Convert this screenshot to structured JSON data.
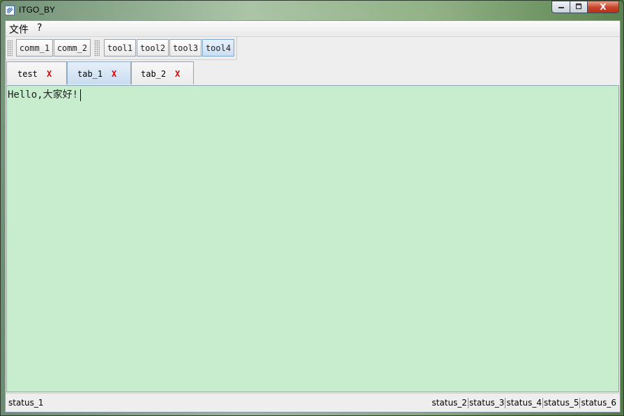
{
  "window": {
    "title": "ITGO_BY",
    "icon": "app-logo-icon",
    "caption_buttons": {
      "minimize": "minimize-icon",
      "maximize": "maximize-icon",
      "close_label": "X"
    }
  },
  "menubar": {
    "items": [
      {
        "label": "文件"
      },
      {
        "label": "?"
      }
    ]
  },
  "toolbar": {
    "group1": [
      {
        "label": "comm_1"
      },
      {
        "label": "comm_2"
      }
    ],
    "group2": [
      {
        "label": "tool1"
      },
      {
        "label": "tool2"
      },
      {
        "label": "tool3"
      },
      {
        "label": "tool4",
        "active": true
      }
    ]
  },
  "tabs": [
    {
      "label": "test",
      "close": "X",
      "selected": false
    },
    {
      "label": "tab_1",
      "close": "X",
      "selected": true
    },
    {
      "label": "tab_2",
      "close": "X",
      "selected": false
    }
  ],
  "editor": {
    "content": "Hello,大家好!",
    "background": "#c8ecce"
  },
  "statusbar": {
    "left": "status_1",
    "right": [
      "status_2",
      "status_3",
      "status_4",
      "status_5",
      "status_6"
    ]
  },
  "colors": {
    "tab_close": "#e00000",
    "selected_tab": "#c9dcf0",
    "editor_bg": "#c8ecce"
  }
}
